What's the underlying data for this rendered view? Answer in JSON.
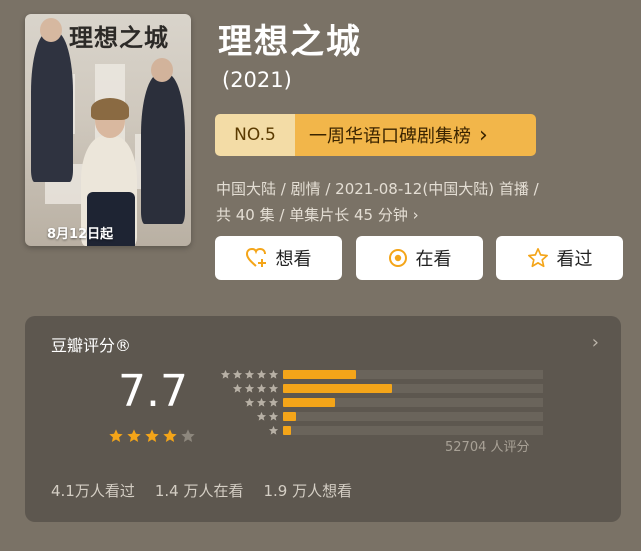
{
  "poster": {
    "title_text": "理想之城",
    "date_text": "8月12日起"
  },
  "show": {
    "title": "理想之城",
    "year": "(2021)"
  },
  "rank": {
    "no": "NO.5",
    "text": "一周华语口碑剧集榜",
    "arrow": "›"
  },
  "meta": {
    "line1": "中国大陆 / 剧情 / 2021-08-12(中国大陆) 首播 /",
    "line2": "共 40 集 / 单集片长 45 分钟 ›"
  },
  "buttons": [
    {
      "label": "想看",
      "icon": "heart-plus-icon"
    },
    {
      "label": "在看",
      "icon": "target-icon"
    },
    {
      "label": "看过",
      "icon": "star-outline-icon"
    }
  ],
  "rating": {
    "label": "豆瓣评分®",
    "score": "7.7",
    "stars_filled": 4,
    "stars_total": 5,
    "distribution": [
      {
        "stars": 5,
        "fraction": 0.28
      },
      {
        "stars": 4,
        "fraction": 0.42
      },
      {
        "stars": 3,
        "fraction": 0.2
      },
      {
        "stars": 2,
        "fraction": 0.05
      },
      {
        "stars": 1,
        "fraction": 0.03
      }
    ],
    "count_text": "52704 人评分",
    "arrow": "›"
  },
  "stats": {
    "watched": "4.1万人看过",
    "watching": "1.4 万人在看",
    "want": "1.9 万人想看"
  },
  "colors": {
    "background": "#7a7266",
    "accent": "#f4a519",
    "badge_light": "#f3dca6",
    "card": "#5d574f"
  }
}
